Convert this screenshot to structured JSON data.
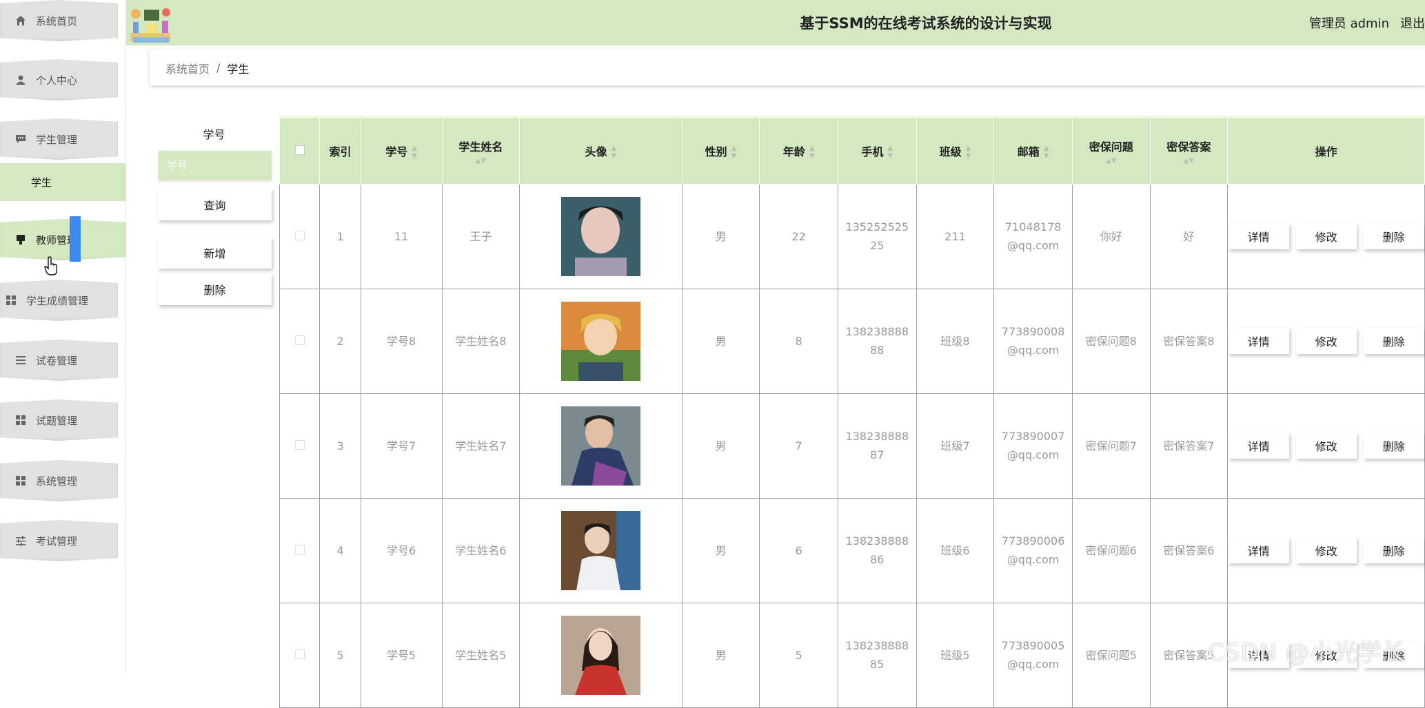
{
  "sidebar": {
    "items": [
      {
        "label": "系统首页",
        "icon": "home-icon"
      },
      {
        "label": "个人中心",
        "icon": "user-icon"
      },
      {
        "label": "学生管理",
        "icon": "chat-icon"
      },
      {
        "label": "教师管理",
        "icon": "brush-icon"
      },
      {
        "label": "学生成绩管理",
        "icon": "grid-icon"
      },
      {
        "label": "试卷管理",
        "icon": "list-icon"
      },
      {
        "label": "试题管理",
        "icon": "grid-icon"
      },
      {
        "label": "系统管理",
        "icon": "grid-icon"
      },
      {
        "label": "考试管理",
        "icon": "sliders-icon"
      }
    ],
    "sub_item": "学生"
  },
  "header": {
    "title": "基于SSM的在线考试系统的设计与实现",
    "role": "管理员",
    "user": "admin",
    "logout": "退出"
  },
  "breadcrumb": {
    "home": "系统首页",
    "separator": "/",
    "current": "学生"
  },
  "search": {
    "label": "学号",
    "placeholder": "学号",
    "query_button": "查询",
    "add_button": "新增",
    "delete_button": "删除"
  },
  "table": {
    "headers": {
      "index": "索引",
      "student_no": "学号",
      "name": "学生姓名",
      "avatar": "头像",
      "gender": "性别",
      "age": "年龄",
      "phone": "手机",
      "class": "班级",
      "email": "邮箱",
      "question": "密保问题",
      "answer": "密保答案",
      "actions": "操作"
    },
    "rows": [
      {
        "index": "1",
        "student_no": "11",
        "name": "王子",
        "gender": "男",
        "age": "22",
        "phone_1": "135252525",
        "phone_2": "25",
        "class": "211",
        "email_1": "71048178",
        "email_2": "@qq.com",
        "question": "你好",
        "answer": "好"
      },
      {
        "index": "2",
        "student_no": "学号8",
        "name": "学生姓名8",
        "gender": "男",
        "age": "8",
        "phone_1": "138238888",
        "phone_2": "88",
        "class": "班级8",
        "email_1": "773890008",
        "email_2": "@qq.com",
        "question": "密保问题8",
        "answer": "密保答案8"
      },
      {
        "index": "3",
        "student_no": "学号7",
        "name": "学生姓名7",
        "gender": "男",
        "age": "7",
        "phone_1": "138238888",
        "phone_2": "87",
        "class": "班级7",
        "email_1": "773890007",
        "email_2": "@qq.com",
        "question": "密保问题7",
        "answer": "密保答案7"
      },
      {
        "index": "4",
        "student_no": "学号6",
        "name": "学生姓名6",
        "gender": "男",
        "age": "6",
        "phone_1": "138238888",
        "phone_2": "86",
        "class": "班级6",
        "email_1": "773890006",
        "email_2": "@qq.com",
        "question": "密保问题6",
        "answer": "密保答案6"
      },
      {
        "index": "5",
        "student_no": "学号5",
        "name": "学生姓名5",
        "gender": "男",
        "age": "5",
        "phone_1": "138238888",
        "phone_2": "85",
        "class": "班级5",
        "email_1": "773890005",
        "email_2": "@qq.com",
        "question": "密保问题5",
        "answer": "密保答案5"
      }
    ],
    "actions": {
      "detail": "详情",
      "edit": "修改",
      "delete": "删除"
    }
  },
  "watermark": "CSDN @小光学长",
  "colors": {
    "accent": "#d4e9c2",
    "scroll_highlight": "#3d8bf1"
  }
}
